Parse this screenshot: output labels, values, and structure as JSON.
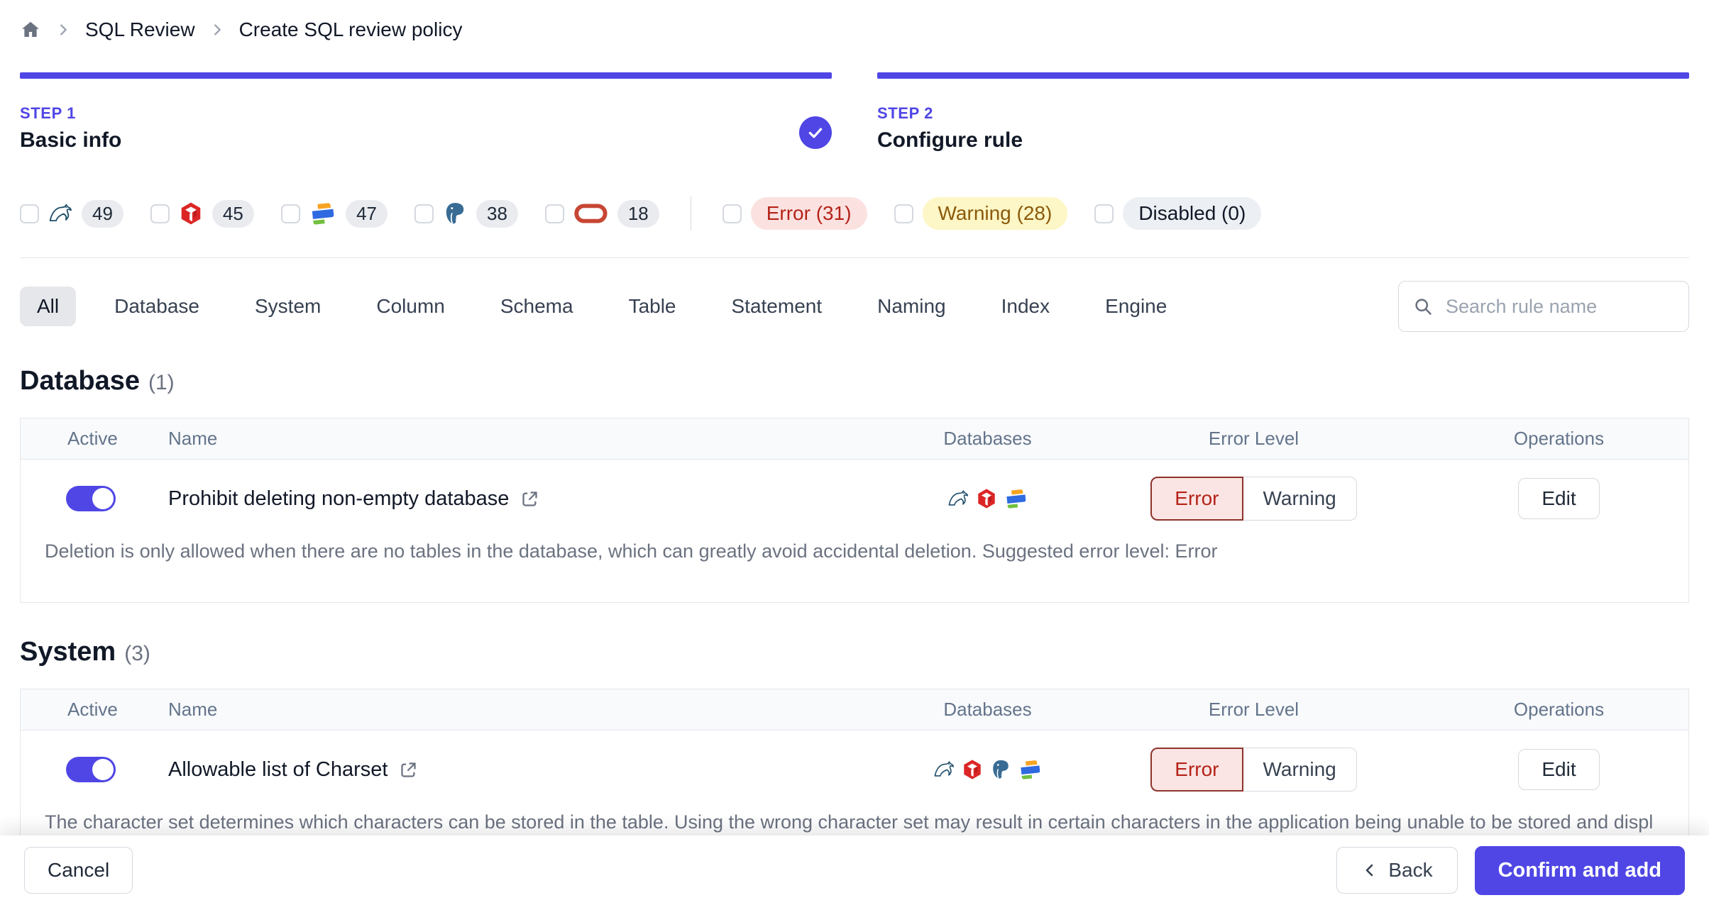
{
  "breadcrumb": {
    "home_icon": "home-icon",
    "link": "SQL Review",
    "current": "Create SQL review policy"
  },
  "steps": [
    {
      "label": "STEP 1",
      "title": "Basic info",
      "completed": true
    },
    {
      "label": "STEP 2",
      "title": "Configure rule",
      "completed": false
    }
  ],
  "filters": {
    "engines": [
      {
        "engine": "mysql",
        "count": "49"
      },
      {
        "engine": "tidb",
        "count": "45"
      },
      {
        "engine": "oceanbase",
        "count": "47"
      },
      {
        "engine": "postgresql",
        "count": "38"
      },
      {
        "engine": "oracle",
        "count": "18"
      }
    ],
    "levels": [
      {
        "type": "error",
        "label": "Error (31)"
      },
      {
        "type": "warning",
        "label": "Warning (28)"
      },
      {
        "type": "disabled",
        "label": "Disabled (0)"
      }
    ]
  },
  "tabs": {
    "selected": "All",
    "items": [
      "All",
      "Database",
      "System",
      "Column",
      "Schema",
      "Table",
      "Statement",
      "Naming",
      "Index",
      "Engine"
    ]
  },
  "search": {
    "placeholder": "Search rule name",
    "icon": "search-icon"
  },
  "table_columns": {
    "active": "Active",
    "name": "Name",
    "databases": "Databases",
    "error_level": "Error Level",
    "operations": "Operations"
  },
  "sections": [
    {
      "title": "Database",
      "count": "(1)",
      "rules": [
        {
          "name": "Prohibit deleting non-empty database",
          "active": true,
          "engines": [
            "mysql",
            "tidb",
            "oceanbase"
          ],
          "selected_level": "Error",
          "level_options": {
            "error": "Error",
            "warning": "Warning"
          },
          "operation": "Edit",
          "description": "Deletion is only allowed when there are no tables in the database, which can greatly avoid accidental deletion. Suggested error level: Error"
        }
      ]
    },
    {
      "title": "System",
      "count": "(3)",
      "rules": [
        {
          "name": "Allowable list of Charset",
          "active": true,
          "engines": [
            "mysql",
            "tidb",
            "postgresql",
            "oceanbase"
          ],
          "selected_level": "Error",
          "level_options": {
            "error": "Error",
            "warning": "Warning"
          },
          "operation": "Edit",
          "description": "The character set determines which characters can be stored in the table. Using the wrong character set may result in certain characters in the application being unable to be stored and displayed correctly, such as CJK and Emoji. Suggested error level: Error"
        }
      ]
    }
  ],
  "footer": {
    "cancel": "Cancel",
    "back": "Back",
    "confirm": "Confirm and add"
  },
  "colors": {
    "accent": "#4f46e5",
    "error_text": "#b42318",
    "error_bg": "#fbe2e1",
    "error_border": "#8e332c",
    "warning_text": "#8a5a0b",
    "warning_bg": "#fdf6c6",
    "disabled_bg": "#eceff3"
  }
}
